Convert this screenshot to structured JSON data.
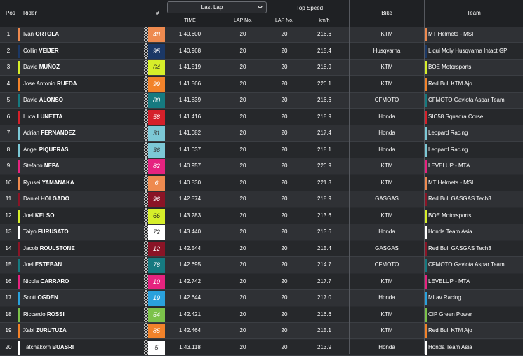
{
  "header": {
    "pos": "Pos",
    "rider": "Rider",
    "number": "#",
    "last_lap_select": "Last Lap",
    "time": "TIME",
    "lap_no": "LAP No.",
    "top_speed": "Top Speed",
    "top_lap_no": "LAP No.",
    "kmh": "km/h",
    "bike": "Bike",
    "team": "Team"
  },
  "rows": [
    {
      "pos": "1",
      "first": "Ivan",
      "last": "ORTOLA",
      "num": "48",
      "num_bg": "#ee8a4f",
      "num_fg": "#ffffff",
      "time": "1:40.600",
      "lap": "20",
      "tlap": "20",
      "kmh": "216.6",
      "bike": "KTM",
      "team": "MT Helmets - MSI",
      "rider_color": "#ee8a4f",
      "team_color": "#ee8a4f"
    },
    {
      "pos": "2",
      "first": "Collin",
      "last": "VEIJER",
      "num": "95",
      "num_bg": "#1b3866",
      "num_fg": "#ffffff",
      "time": "1:40.968",
      "lap": "20",
      "tlap": "20",
      "kmh": "215.4",
      "bike": "Husqvarna",
      "team": "Liqui Moly Husqvarna Intact GP",
      "rider_color": "#1b3866",
      "team_color": "#1b3866"
    },
    {
      "pos": "3",
      "first": "David",
      "last": "MUÑOZ",
      "num": "64",
      "num_bg": "#d6ee2a",
      "num_fg": "#222222",
      "time": "1:41.519",
      "lap": "20",
      "tlap": "20",
      "kmh": "218.9",
      "bike": "KTM",
      "team": "BOE Motorsports",
      "rider_color": "#d6ee2a",
      "team_color": "#d6ee2a"
    },
    {
      "pos": "4",
      "first": "Jose Antonio",
      "last": "RUEDA",
      "num": "99",
      "num_bg": "#f2822a",
      "num_fg": "#ffffff",
      "time": "1:41.566",
      "lap": "20",
      "tlap": "20",
      "kmh": "220.1",
      "bike": "KTM",
      "team": "Red Bull KTM Ajo",
      "rider_color": "#f2822a",
      "team_color": "#f2822a"
    },
    {
      "pos": "5",
      "first": "David",
      "last": "ALONSO",
      "num": "80",
      "num_bg": "#167a80",
      "num_fg": "#ffffff",
      "time": "1:41.839",
      "lap": "20",
      "tlap": "20",
      "kmh": "216.6",
      "bike": "CFMOTO",
      "team": "CFMOTO Gaviota  Aspar Team",
      "rider_color": "#167a80",
      "team_color": "#167a80"
    },
    {
      "pos": "6",
      "first": "Luca",
      "last": "LUNETTA",
      "num": "58",
      "num_bg": "#d5202a",
      "num_fg": "#ffffff",
      "time": "1:41.416",
      "lap": "20",
      "tlap": "20",
      "kmh": "218.9",
      "bike": "Honda",
      "team": "SIC58 Squadra Corse",
      "rider_color": "#d5202a",
      "team_color": "#d5202a"
    },
    {
      "pos": "7",
      "first": "Adrian",
      "last": "FERNANDEZ",
      "num": "31",
      "num_bg": "#7cc8d6",
      "num_fg": "#333333",
      "time": "1:41.082",
      "lap": "20",
      "tlap": "20",
      "kmh": "217.4",
      "bike": "Honda",
      "team": "Leopard Racing",
      "rider_color": "#7cc8d6",
      "team_color": "#7cc8d6"
    },
    {
      "pos": "8",
      "first": "Angel",
      "last": "PIQUERAS",
      "num": "36",
      "num_bg": "#7cc8d6",
      "num_fg": "#333333",
      "time": "1:41.037",
      "lap": "20",
      "tlap": "20",
      "kmh": "218.1",
      "bike": "Honda",
      "team": "Leopard Racing",
      "rider_color": "#7cc8d6",
      "team_color": "#7cc8d6"
    },
    {
      "pos": "9",
      "first": "Stefano",
      "last": "NEPA",
      "num": "82",
      "num_bg": "#e6237f",
      "num_fg": "#ffffff",
      "time": "1:40.957",
      "lap": "20",
      "tlap": "20",
      "kmh": "220.9",
      "bike": "KTM",
      "team": "LEVELUP - MTA",
      "rider_color": "#e6237f",
      "team_color": "#e6237f"
    },
    {
      "pos": "10",
      "first": "Ryusei",
      "last": "YAMANAKA",
      "num": "6",
      "num_bg": "#ee8a4f",
      "num_fg": "#ffffff",
      "time": "1:40.830",
      "lap": "20",
      "tlap": "20",
      "kmh": "221.3",
      "bike": "KTM",
      "team": "MT Helmets - MSI",
      "rider_color": "#ee8a4f",
      "team_color": "#ee8a4f"
    },
    {
      "pos": "11",
      "first": "Daniel",
      "last": "HOLGADO",
      "num": "96",
      "num_bg": "#8a1426",
      "num_fg": "#ffffff",
      "time": "1:42.574",
      "lap": "20",
      "tlap": "20",
      "kmh": "218.9",
      "bike": "GASGAS",
      "team": "Red Bull GASGAS Tech3",
      "rider_color": "#8a1426",
      "team_color": "#8a1426"
    },
    {
      "pos": "12",
      "first": "Joel",
      "last": "KELSO",
      "num": "66",
      "num_bg": "#d6ee2a",
      "num_fg": "#222222",
      "time": "1:43.283",
      "lap": "20",
      "tlap": "20",
      "kmh": "213.6",
      "bike": "KTM",
      "team": "BOE Motorsports",
      "rider_color": "#d6ee2a",
      "team_color": "#d6ee2a"
    },
    {
      "pos": "13",
      "first": "Taiyo",
      "last": "FURUSATO",
      "num": "72",
      "num_bg": "#ffffff",
      "num_fg": "#333333",
      "time": "1:43.440",
      "lap": "20",
      "tlap": "20",
      "kmh": "213.6",
      "bike": "Honda",
      "team": "Honda Team Asia",
      "rider_color": "#ffffff",
      "team_color": "#ffffff"
    },
    {
      "pos": "14",
      "first": "Jacob",
      "last": "ROULSTONE",
      "num": "12",
      "num_bg": "#8a1426",
      "num_fg": "#ffffff",
      "time": "1:42.544",
      "lap": "20",
      "tlap": "20",
      "kmh": "215.4",
      "bike": "GASGAS",
      "team": "Red Bull GASGAS Tech3",
      "rider_color": "#8a1426",
      "team_color": "#8a1426"
    },
    {
      "pos": "15",
      "first": "Joel",
      "last": "ESTEBAN",
      "num": "78",
      "num_bg": "#167a80",
      "num_fg": "#ffffff",
      "time": "1:42.695",
      "lap": "20",
      "tlap": "20",
      "kmh": "214.7",
      "bike": "CFMOTO",
      "team": "CFMOTO Gaviota  Aspar Team",
      "rider_color": "#167a80",
      "team_color": "#167a80"
    },
    {
      "pos": "16",
      "first": "Nicola",
      "last": "CARRARO",
      "num": "10",
      "num_bg": "#e6237f",
      "num_fg": "#ffffff",
      "time": "1:42.742",
      "lap": "20",
      "tlap": "20",
      "kmh": "217.7",
      "bike": "KTM",
      "team": "LEVELUP - MTA",
      "rider_color": "#e6237f",
      "team_color": "#e6237f"
    },
    {
      "pos": "17",
      "first": "Scott",
      "last": "OGDEN",
      "num": "19",
      "num_bg": "#2aa1dc",
      "num_fg": "#ffffff",
      "time": "1:42.644",
      "lap": "20",
      "tlap": "20",
      "kmh": "217.0",
      "bike": "Honda",
      "team": "MLav Racing",
      "rider_color": "#2aa1dc",
      "team_color": "#2aa1dc"
    },
    {
      "pos": "18",
      "first": "Riccardo",
      "last": "ROSSI",
      "num": "54",
      "num_bg": "#7cc24a",
      "num_fg": "#ffffff",
      "time": "1:42.421",
      "lap": "20",
      "tlap": "20",
      "kmh": "216.6",
      "bike": "KTM",
      "team": "CIP Green Power",
      "rider_color": "#7cc24a",
      "team_color": "#7cc24a"
    },
    {
      "pos": "19",
      "first": "Xabi",
      "last": "ZURUTUZA",
      "num": "85",
      "num_bg": "#f2822a",
      "num_fg": "#ffffff",
      "time": "1:42.464",
      "lap": "20",
      "tlap": "20",
      "kmh": "215.1",
      "bike": "KTM",
      "team": "Red Bull KTM Ajo",
      "rider_color": "#f2822a",
      "team_color": "#f2822a"
    },
    {
      "pos": "20",
      "first": "Tatchakorn",
      "last": "BUASRI",
      "num": "5",
      "num_bg": "#ffffff",
      "num_fg": "#333333",
      "time": "1:43.118",
      "lap": "20",
      "tlap": "20",
      "kmh": "213.9",
      "bike": "Honda",
      "team": "Honda Team Asia",
      "rider_color": "#ffffff",
      "team_color": "#ffffff"
    }
  ]
}
